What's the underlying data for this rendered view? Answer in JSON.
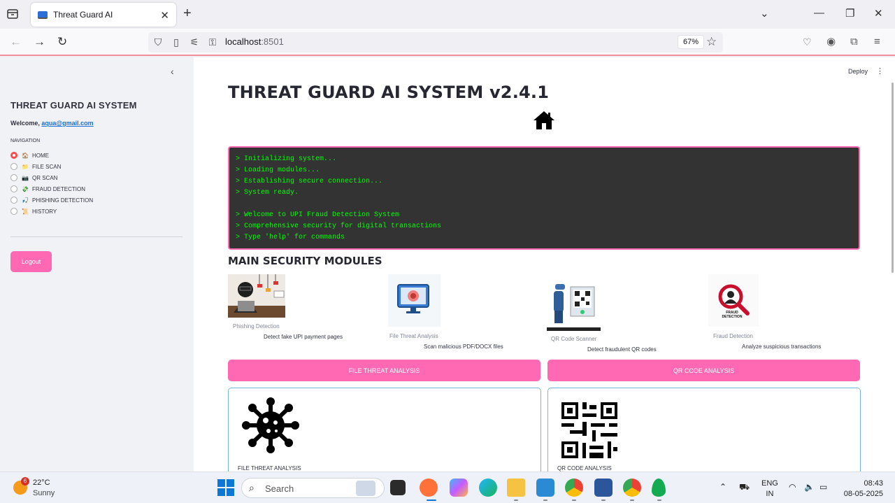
{
  "browser": {
    "tab_title": "Threat Guard AI",
    "url_host": "localhost",
    "url_port": ":8501",
    "zoom": "67%"
  },
  "sidebar": {
    "title": "THREAT GUARD AI SYSTEM",
    "welcome_prefix": "Welcome, ",
    "email": "aqua@gmail.com",
    "nav_label": "NAVIGATION",
    "items": [
      {
        "label": "HOME",
        "emoji": "🏠",
        "selected": true
      },
      {
        "label": "FILE SCAN",
        "emoji": "📁",
        "selected": false
      },
      {
        "label": "QR SCAN",
        "emoji": "📷",
        "selected": false
      },
      {
        "label": "FRAUD DETECTION",
        "emoji": "💸",
        "selected": false
      },
      {
        "label": "PHISHING DETECTION",
        "emoji": "🎣",
        "selected": false
      },
      {
        "label": "HISTORY",
        "emoji": "📜",
        "selected": false
      }
    ],
    "logout_label": "Logout"
  },
  "main": {
    "deploy_label": "Deploy",
    "title": "THREAT GUARD AI SYSTEM v2.4.1",
    "terminal_lines": [
      "> Initializing system...",
      "> Loading modules...",
      "> Establishing secure connection...",
      "> System ready.",
      "",
      "> Welcome to UPI Fraud Detection System",
      "> Comprehensive security for digital transactions",
      "> Type 'help' for commands"
    ],
    "modules_title": "MAIN SECURITY MODULES",
    "modules": [
      {
        "caption": "Phishing Detection",
        "description": "Detect fake UPI payment pages"
      },
      {
        "caption": "File Threat Analysis",
        "description": "Scan malicious PDF/DOCX files"
      },
      {
        "caption": "QR Code Scanner",
        "description": "Detect fraudulent QR codes"
      },
      {
        "caption": "Fraud Detection",
        "description": "Analyze suspicious transactions",
        "image_text": "FRAUD DETECTION"
      }
    ],
    "buttons": {
      "file_threat": "FILE THREAT ANALYSIS",
      "qr_code": "QR CODE ANALYSIS"
    },
    "cards": {
      "file_caption": "FILE THREAT ANALYSIS",
      "qr_caption": "QR CODE ANALYSIS"
    }
  },
  "taskbar": {
    "weather_badge": "6",
    "temperature": "22°C",
    "condition": "Sunny",
    "search_label": "Search",
    "lang_1": "ENG",
    "lang_2": "IN",
    "time": "08:43",
    "date": "08-05-2025"
  },
  "colors": {
    "accent_pink": "#ff69b4",
    "terminal_bg": "#333333",
    "terminal_text": "#00ff00",
    "radio_selected": "#ff4b4b"
  }
}
